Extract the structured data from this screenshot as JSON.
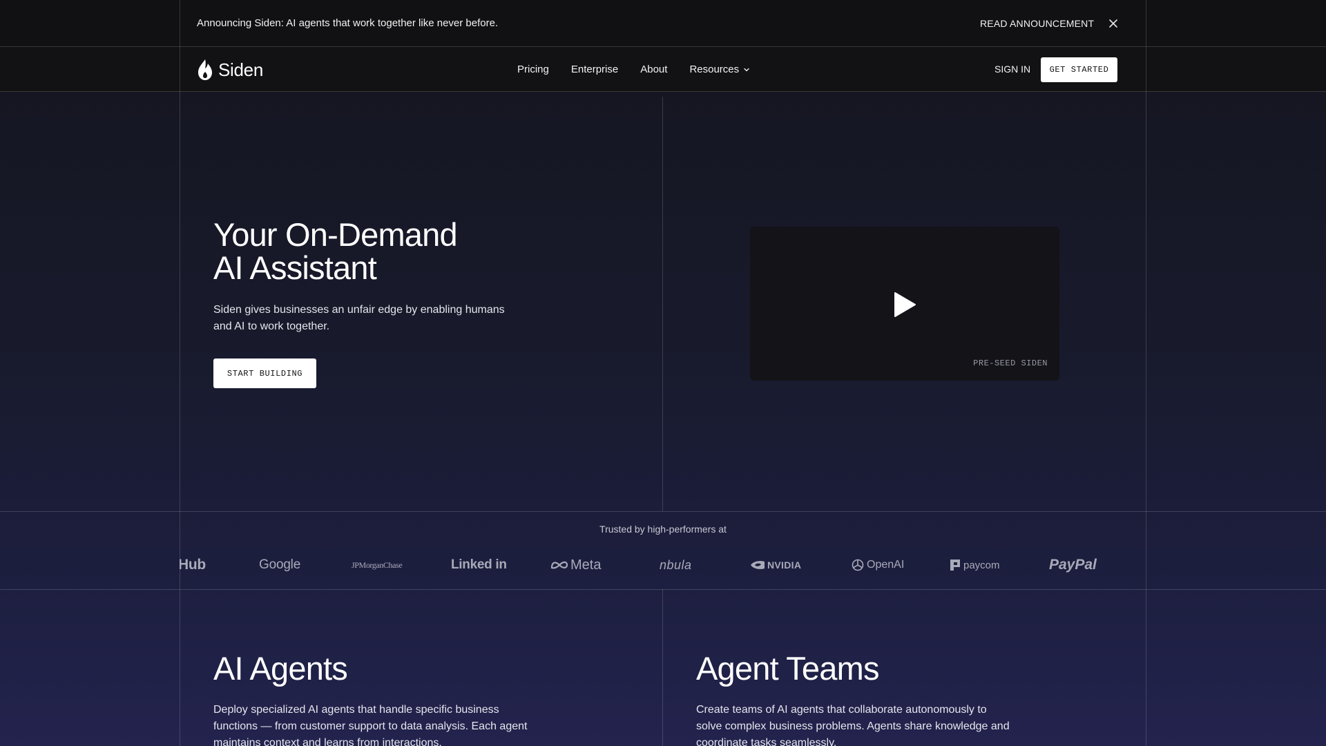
{
  "announcement": {
    "text": "Announcing Siden: AI agents that work together like never before.",
    "link": "READ ANNOUNCEMENT"
  },
  "nav": {
    "brand": "Siden",
    "links": [
      "Pricing",
      "Enterprise",
      "About",
      "Resources"
    ],
    "sign_in": "SIGN IN",
    "get_started": "GET STARTED"
  },
  "hero": {
    "title_line1": "Your On-Demand",
    "title_line2": "AI Assistant",
    "subtitle": "Siden gives businesses an unfair edge by enabling humans and AI to work together.",
    "cta": "START BUILDING"
  },
  "video": {
    "caption": "PRE-SEED SIDEN"
  },
  "trusted": {
    "label": "Trusted by high-performers at",
    "logos": [
      "Hub",
      "Google",
      "JPMorganChase",
      "Linked in",
      "Meta",
      "nbula",
      "NVIDIA",
      "OpenAI",
      "paycom",
      "PayPal"
    ]
  },
  "features": [
    {
      "title": "AI Agents",
      "description": "Deploy specialized AI agents that handle specific business functions — from customer support to data analysis. Each agent maintains context and learns from interactions."
    },
    {
      "title": "Agent Teams",
      "description": "Create teams of AI agents that collaborate autonomously to solve complex business problems. Agents share knowledge and coordinate tasks seamlessly."
    }
  ],
  "colors": {
    "background_top": "#15151f",
    "background_bottom": "#23234e",
    "bar": "#111113",
    "button": "#ffffff"
  }
}
